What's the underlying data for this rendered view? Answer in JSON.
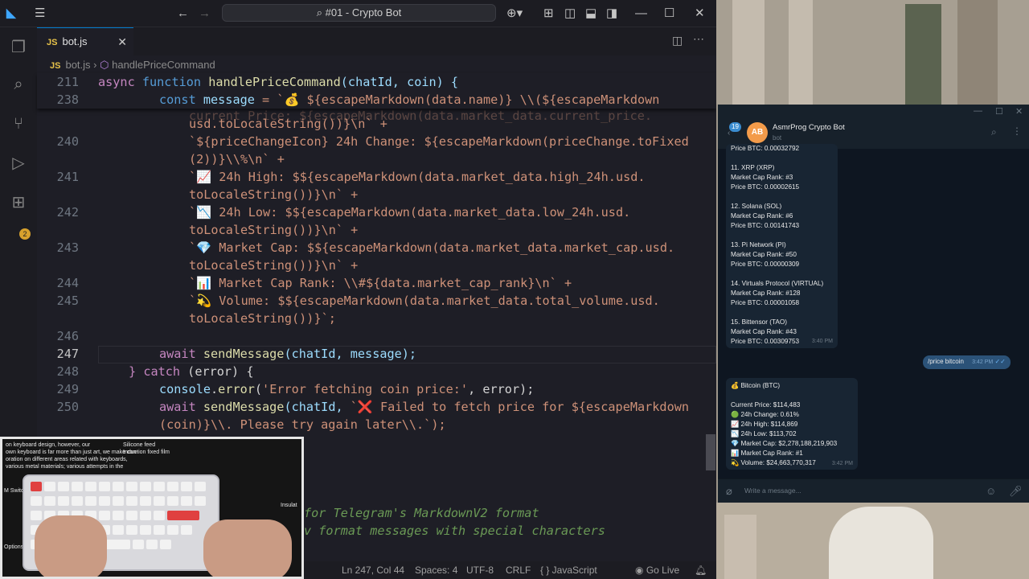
{
  "titlebar": {
    "command_center": "#01 - Crypto Bot"
  },
  "tab": {
    "label": "bot.js",
    "badge": "JS"
  },
  "breadcrumb": {
    "file": "bot.js",
    "symbol": "handlePriceCommand"
  },
  "code": {
    "line_numbers": {
      "l211": "211",
      "l238": "238",
      "l240": "240",
      "l241": "241",
      "l242": "242",
      "l243": "243",
      "l244": "244",
      "l245": "245",
      "l246": "246",
      "l247": "247",
      "l248": "248",
      "l249": "249",
      "l250": "250"
    },
    "sticky1": {
      "kw": "async",
      "kw2": "function",
      "fn": "handlePriceCommand",
      "params": "(chatId, coin) {"
    },
    "sticky2": {
      "kw": "const",
      "var": "message",
      "rest": " = `💰 ${escapeMarkdown(data.name)} \\\\(${escapeMarkdown"
    },
    "hidden_line": "current Price: ${escapeMarkdown(data.market_data.current_price.",
    "w239": "usd.toLocaleString())}\\n` +",
    "w240a": "`${priceChangeIcon} 24h Change: ${escapeMarkdown(priceChange.toFixed",
    "w240b": "(2))}\\\\%\\n` +",
    "w241a": "`📈 24h High: $${escapeMarkdown(data.market_data.high_24h.usd.",
    "w241b": "toLocaleString())}\\n` +",
    "w242a": "`📉 24h Low: $${escapeMarkdown(data.market_data.low_24h.usd.",
    "w242b": "toLocaleString())}\\n` +",
    "w243a": "`💎 Market Cap: $${escapeMarkdown(data.market_data.market_cap.usd.",
    "w243b": "toLocaleString())}\\n` +",
    "w244": "`📊 Market Cap Rank: \\\\#${data.market_cap_rank}\\n` +",
    "w245a": "`💫 Volume: $${escapeMarkdown(data.market_data.total_volume.usd.",
    "w245b": "toLocaleString())}`;",
    "l247": {
      "kw": "await",
      "fn": "sendMessage",
      "rest": "(chatId, message);"
    },
    "l248": {
      "brace": "}",
      "kw": "catch",
      "rest": " (error) {"
    },
    "l249": {
      "obj": "console",
      "fn": "error",
      "str": "'Error fetching coin price:'",
      "rest": ", error);"
    },
    "l250a": {
      "kw": "await",
      "fn": "sendMessage",
      "pre": "(chatId, ",
      "str": "`❌ Failed to fetch price for ${escapeMarkdown"
    },
    "l250b": "(coin)}\\\\. Please try again later\\\\.`);",
    "comment1": "for Telegram's MarkdownV2 format",
    "comment2": "v format messages with special characters"
  },
  "statusbar": {
    "position": "Ln 247, Col 44",
    "spaces": "Spaces: 4",
    "encoding": "UTF-8",
    "eol": "CRLF",
    "language": "{ } JavaScript",
    "golive": "Go Live"
  },
  "activity": {
    "badge": "2"
  },
  "webcam": {
    "text1": "on keyboard design, however, our",
    "text2": "own keyboard is far more than just art, we make con-",
    "text3": "oration on different areas related with keyboards,",
    "text4": "various metal materials; various attempts in the",
    "text5": "Silicone feed",
    "text6": "Induction fixed film",
    "text7": "Insulat",
    "text8": "Options",
    "text9": "M Switch"
  },
  "telegram": {
    "name": "AsmrProg Crypto Bot",
    "sub": "bot",
    "avatar": "AB",
    "back_badge": "19",
    "list": [
      "Price BTC: 0.00032792",
      "",
      "11. XRP (XRP)",
      "Market Cap Rank: #3",
      "Price BTC: 0.00002615",
      "",
      "12. Solana (SOL)",
      "Market Cap Rank: #6",
      "Price BTC: 0.00141743",
      "",
      "13. Pi Network (PI)",
      "Market Cap Rank: #50",
      "Price BTC: 0.00000309",
      "",
      "14. Virtuals Protocol (VIRTUAL)",
      "Market Cap Rank: #128",
      "Price BTC: 0.00001058",
      "",
      "15. Bittensor (TAO)",
      "Market Cap Rank: #43",
      "Price BTC: 0.00309753"
    ],
    "list_time": "3:40 PM",
    "out_text": "/price bitcoin",
    "out_time": "3:42 PM",
    "price_lines": [
      "💰 Bitcoin (BTC)",
      "",
      "Current Price: $114,483",
      "🟢 24h Change: 0.61%",
      "📈 24h High: $114,869",
      "📉 24h Low: $113,702",
      "💎 Market Cap: $2,278,188,219,903",
      "📊 Market Cap Rank: #1",
      "💫 Volume: $24,663,770,317"
    ],
    "price_time": "3:42 PM",
    "input_placeholder": "Write a message..."
  }
}
